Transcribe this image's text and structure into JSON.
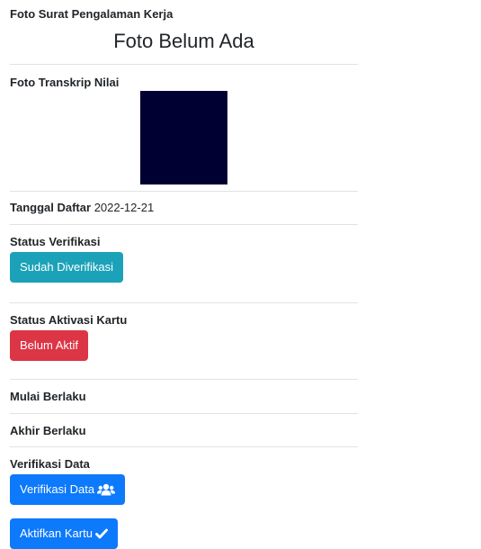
{
  "surat_pengalaman": {
    "label": "Foto Surat Pengalaman Kerja",
    "placeholder": "Foto Belum Ada"
  },
  "transkrip": {
    "label": "Foto Transkrip Nilai"
  },
  "tanggal_daftar": {
    "label": "Tanggal Daftar",
    "value": "2022-12-21"
  },
  "status_verifikasi": {
    "label": "Status Verifikasi",
    "button": "Sudah Diverifikasi"
  },
  "status_aktivasi": {
    "label": "Status Aktivasi Kartu",
    "button": "Belum Aktif"
  },
  "mulai_berlaku": {
    "label": "Mulai Berlaku"
  },
  "akhir_berlaku": {
    "label": "Akhir Berlaku"
  },
  "verifikasi_data": {
    "label": "Verifikasi Data",
    "verify_button": "Verifikasi Data",
    "verify_icon": "users-icon",
    "activate_button": "Aktifkan Kartu",
    "activate_icon": "check-icon"
  },
  "colors": {
    "info": "#1ba2b8",
    "danger": "#dc3545",
    "primary": "#0d79fb",
    "photo": "#000033"
  }
}
